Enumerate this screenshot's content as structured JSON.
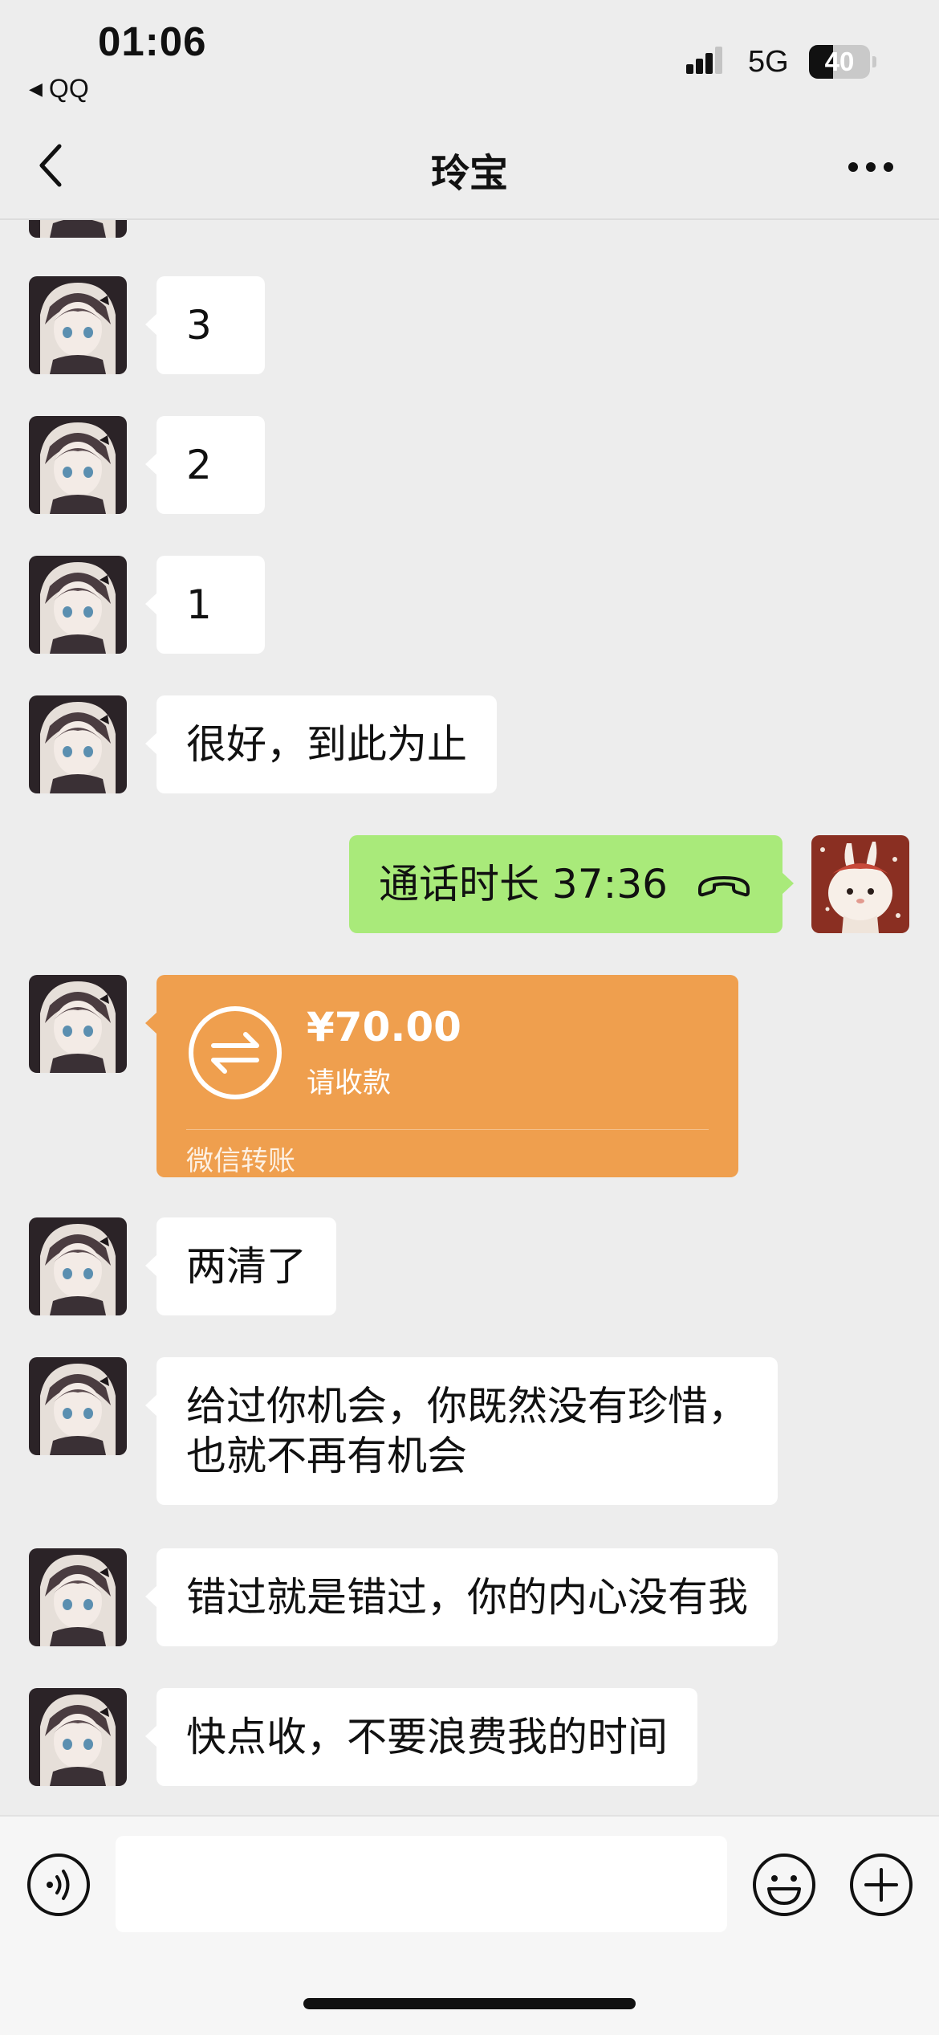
{
  "status_bar": {
    "time": "01:06",
    "back_app": "QQ",
    "network": "5G",
    "battery_level": "40"
  },
  "nav": {
    "title": "玲宝"
  },
  "messages": [
    {
      "type": "text",
      "from": "contact",
      "text": ""
    },
    {
      "type": "text",
      "from": "contact",
      "text": "3"
    },
    {
      "type": "text",
      "from": "contact",
      "text": "2"
    },
    {
      "type": "text",
      "from": "contact",
      "text": "1"
    },
    {
      "type": "text",
      "from": "contact",
      "text": "很好，到此为止"
    },
    {
      "type": "call",
      "from": "me",
      "text": "通话时长 37:36",
      "icon": "phone-hangup-icon"
    },
    {
      "type": "transfer",
      "from": "contact",
      "amount": "¥70.00",
      "status": "请收款",
      "label": "微信转账"
    },
    {
      "type": "text",
      "from": "contact",
      "text": "两清了"
    },
    {
      "type": "text",
      "from": "contact",
      "lines": [
        "给过你机会，你既然没有珍惜，",
        "也就不再有机会"
      ]
    },
    {
      "type": "text",
      "from": "contact",
      "text": "错过就是错过，你的内心没有我"
    },
    {
      "type": "text",
      "from": "contact",
      "text": "快点收，不要浪费我的时间"
    }
  ],
  "input_bar": {
    "message_value": "",
    "icons": [
      "voice-icon",
      "emoji-icon",
      "plus-icon"
    ]
  },
  "colors": {
    "background": "#ededed",
    "incoming_bubble": "#ffffff",
    "outgoing_bubble": "#a9ea7a",
    "transfer_card": "#ef9f4e"
  }
}
